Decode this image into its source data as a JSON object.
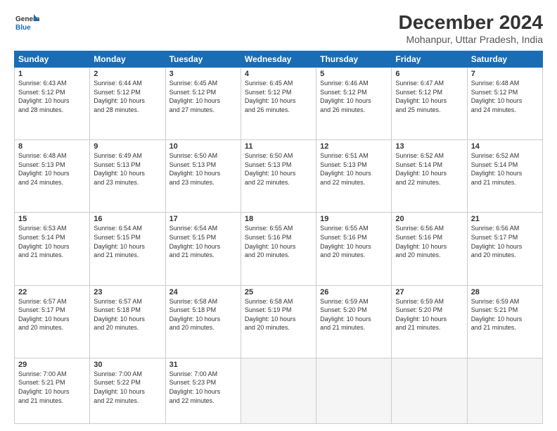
{
  "header": {
    "logo_line1": "General",
    "logo_line2": "Blue",
    "title": "December 2024",
    "subtitle": "Mohanpur, Uttar Pradesh, India"
  },
  "columns": [
    "Sunday",
    "Monday",
    "Tuesday",
    "Wednesday",
    "Thursday",
    "Friday",
    "Saturday"
  ],
  "weeks": [
    [
      {
        "day": "1",
        "info": "Sunrise: 6:43 AM\nSunset: 5:12 PM\nDaylight: 10 hours\nand 28 minutes."
      },
      {
        "day": "2",
        "info": "Sunrise: 6:44 AM\nSunset: 5:12 PM\nDaylight: 10 hours\nand 28 minutes."
      },
      {
        "day": "3",
        "info": "Sunrise: 6:45 AM\nSunset: 5:12 PM\nDaylight: 10 hours\nand 27 minutes."
      },
      {
        "day": "4",
        "info": "Sunrise: 6:45 AM\nSunset: 5:12 PM\nDaylight: 10 hours\nand 26 minutes."
      },
      {
        "day": "5",
        "info": "Sunrise: 6:46 AM\nSunset: 5:12 PM\nDaylight: 10 hours\nand 26 minutes."
      },
      {
        "day": "6",
        "info": "Sunrise: 6:47 AM\nSunset: 5:12 PM\nDaylight: 10 hours\nand 25 minutes."
      },
      {
        "day": "7",
        "info": "Sunrise: 6:48 AM\nSunset: 5:12 PM\nDaylight: 10 hours\nand 24 minutes."
      }
    ],
    [
      {
        "day": "8",
        "info": "Sunrise: 6:48 AM\nSunset: 5:13 PM\nDaylight: 10 hours\nand 24 minutes."
      },
      {
        "day": "9",
        "info": "Sunrise: 6:49 AM\nSunset: 5:13 PM\nDaylight: 10 hours\nand 23 minutes."
      },
      {
        "day": "10",
        "info": "Sunrise: 6:50 AM\nSunset: 5:13 PM\nDaylight: 10 hours\nand 23 minutes."
      },
      {
        "day": "11",
        "info": "Sunrise: 6:50 AM\nSunset: 5:13 PM\nDaylight: 10 hours\nand 22 minutes."
      },
      {
        "day": "12",
        "info": "Sunrise: 6:51 AM\nSunset: 5:13 PM\nDaylight: 10 hours\nand 22 minutes."
      },
      {
        "day": "13",
        "info": "Sunrise: 6:52 AM\nSunset: 5:14 PM\nDaylight: 10 hours\nand 22 minutes."
      },
      {
        "day": "14",
        "info": "Sunrise: 6:52 AM\nSunset: 5:14 PM\nDaylight: 10 hours\nand 21 minutes."
      }
    ],
    [
      {
        "day": "15",
        "info": "Sunrise: 6:53 AM\nSunset: 5:14 PM\nDaylight: 10 hours\nand 21 minutes."
      },
      {
        "day": "16",
        "info": "Sunrise: 6:54 AM\nSunset: 5:15 PM\nDaylight: 10 hours\nand 21 minutes."
      },
      {
        "day": "17",
        "info": "Sunrise: 6:54 AM\nSunset: 5:15 PM\nDaylight: 10 hours\nand 21 minutes."
      },
      {
        "day": "18",
        "info": "Sunrise: 6:55 AM\nSunset: 5:16 PM\nDaylight: 10 hours\nand 20 minutes."
      },
      {
        "day": "19",
        "info": "Sunrise: 6:55 AM\nSunset: 5:16 PM\nDaylight: 10 hours\nand 20 minutes."
      },
      {
        "day": "20",
        "info": "Sunrise: 6:56 AM\nSunset: 5:16 PM\nDaylight: 10 hours\nand 20 minutes."
      },
      {
        "day": "21",
        "info": "Sunrise: 6:56 AM\nSunset: 5:17 PM\nDaylight: 10 hours\nand 20 minutes."
      }
    ],
    [
      {
        "day": "22",
        "info": "Sunrise: 6:57 AM\nSunset: 5:17 PM\nDaylight: 10 hours\nand 20 minutes."
      },
      {
        "day": "23",
        "info": "Sunrise: 6:57 AM\nSunset: 5:18 PM\nDaylight: 10 hours\nand 20 minutes."
      },
      {
        "day": "24",
        "info": "Sunrise: 6:58 AM\nSunset: 5:18 PM\nDaylight: 10 hours\nand 20 minutes."
      },
      {
        "day": "25",
        "info": "Sunrise: 6:58 AM\nSunset: 5:19 PM\nDaylight: 10 hours\nand 20 minutes."
      },
      {
        "day": "26",
        "info": "Sunrise: 6:59 AM\nSunset: 5:20 PM\nDaylight: 10 hours\nand 21 minutes."
      },
      {
        "day": "27",
        "info": "Sunrise: 6:59 AM\nSunset: 5:20 PM\nDaylight: 10 hours\nand 21 minutes."
      },
      {
        "day": "28",
        "info": "Sunrise: 6:59 AM\nSunset: 5:21 PM\nDaylight: 10 hours\nand 21 minutes."
      }
    ],
    [
      {
        "day": "29",
        "info": "Sunrise: 7:00 AM\nSunset: 5:21 PM\nDaylight: 10 hours\nand 21 minutes."
      },
      {
        "day": "30",
        "info": "Sunrise: 7:00 AM\nSunset: 5:22 PM\nDaylight: 10 hours\nand 22 minutes."
      },
      {
        "day": "31",
        "info": "Sunrise: 7:00 AM\nSunset: 5:23 PM\nDaylight: 10 hours\nand 22 minutes."
      },
      {
        "day": "",
        "info": ""
      },
      {
        "day": "",
        "info": ""
      },
      {
        "day": "",
        "info": ""
      },
      {
        "day": "",
        "info": ""
      }
    ]
  ]
}
